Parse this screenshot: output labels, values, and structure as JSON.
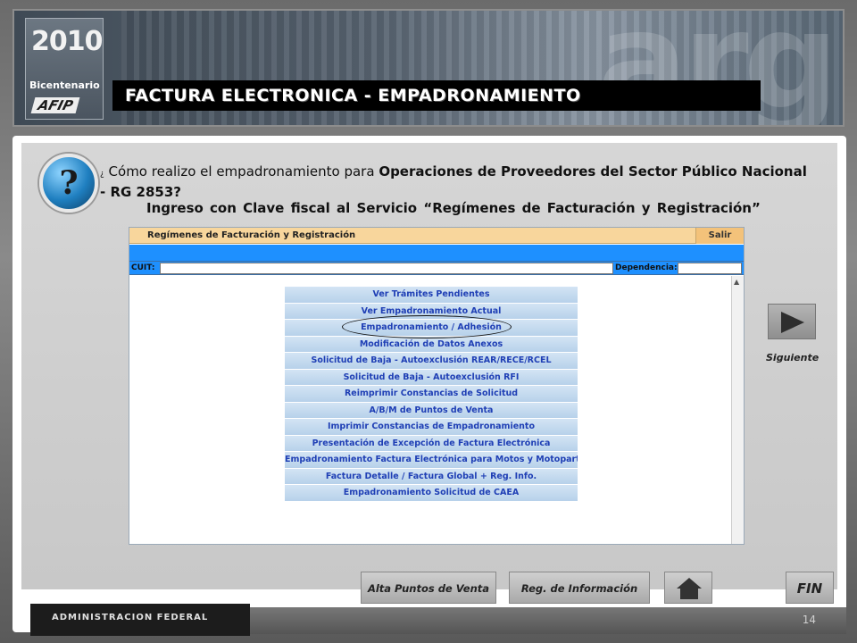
{
  "header": {
    "logo_year": "2010",
    "logo_sub": "2010",
    "logo_text": "Bicentenario",
    "logo_brand": "AFIP",
    "title": "FACTURA ELECTRONICA  - EMPADRONAMIENTO"
  },
  "question": {
    "prefix": "¿",
    "text_plain": " Cómo realizo el empadronamiento para ",
    "text_bold": "Operaciones de Proveedores del Sector Público Nacional - RG 2853?",
    "subtitle": "Ingreso con Clave fiscal al Servicio “Regímenes de Facturación y Registración”"
  },
  "screenshot": {
    "title": "Regímenes de Facturación y Registración",
    "salir": "Salir",
    "cuit_label": "CUIT:",
    "dependencia_label": "Dependencia:",
    "menu": [
      "Ver Trámites Pendientes",
      "Ver Empadronamiento Actual",
      "Empadronamiento / Adhesión",
      "Modificación de Datos Anexos",
      "Solicitud de Baja - Autoexclusión REAR/RECE/RCEL",
      "Solicitud de Baja - Autoexclusión RFI",
      "Reimprimir Constancias de Solicitud",
      "A/B/M de Puntos de Venta",
      "Imprimir Constancias de Empadronamiento",
      "Presentación de Excepción de Factura Electrónica",
      "Empadronamiento Factura Electrónica para Motos y Motopartes",
      "Factura Detalle / Factura Global + Reg. Info.",
      "Empadronamiento Solicitud de CAEA"
    ]
  },
  "navigation": {
    "next_label": "Siguiente",
    "alta_puntos": "Alta Puntos de Venta",
    "reg_informacion": "Reg. de Información",
    "home_icon": "home-icon",
    "fin": "FIN"
  },
  "footer": {
    "org": "ADMINISTRACION FEDERAL",
    "page_number": "14"
  }
}
